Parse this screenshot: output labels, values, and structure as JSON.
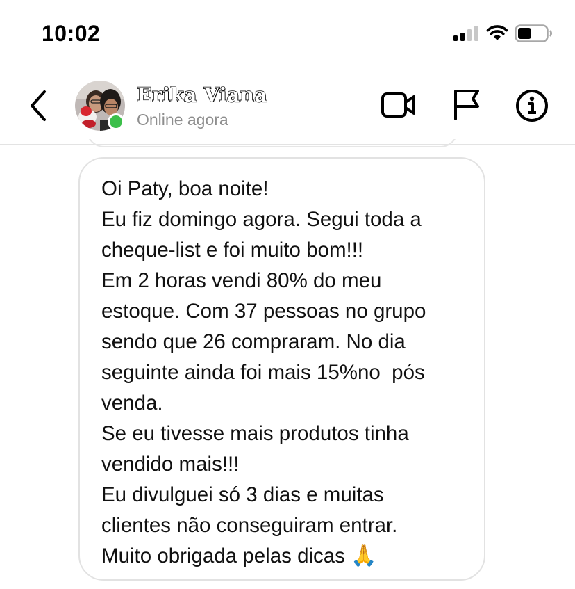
{
  "status_bar": {
    "time": "10:02",
    "signal_icon": "cellular-signal-icon",
    "wifi_icon": "wifi-icon",
    "battery_icon": "battery-icon"
  },
  "header": {
    "back_icon": "chevron-left-icon",
    "contact_name": "Erika Viana",
    "contact_status": "Online agora",
    "online_indicator_color": "#3cbf4a",
    "actions": [
      {
        "icon": "video-camera-icon"
      },
      {
        "icon": "flag-icon"
      },
      {
        "icon": "info-icon"
      }
    ]
  },
  "message": {
    "lines": [
      "Oi Paty, boa noite!",
      "Eu fiz domingo agora. Segui toda a",
      "cheque-list e foi muito bom!!!",
      "Em 2 horas vendi 80% do meu",
      "estoque. Com 37 pessoas no grupo",
      "sendo que 26 compraram. No dia",
      "seguinte ainda foi mais 15%no  pós",
      "venda.",
      "Se eu tivesse mais produtos tinha",
      "vendido mais!!!",
      "Eu divulguei só 3 dias e muitas",
      "clientes não conseguiram entrar.",
      "Muito obrigada pelas dicas"
    ],
    "emoji": "🙏",
    "emoji_name": "folded-hands-emoji"
  },
  "colors": {
    "bubble_border": "#e2e2e2",
    "secondary_text": "#8e8e8e",
    "divider": "#e3e3e3"
  }
}
